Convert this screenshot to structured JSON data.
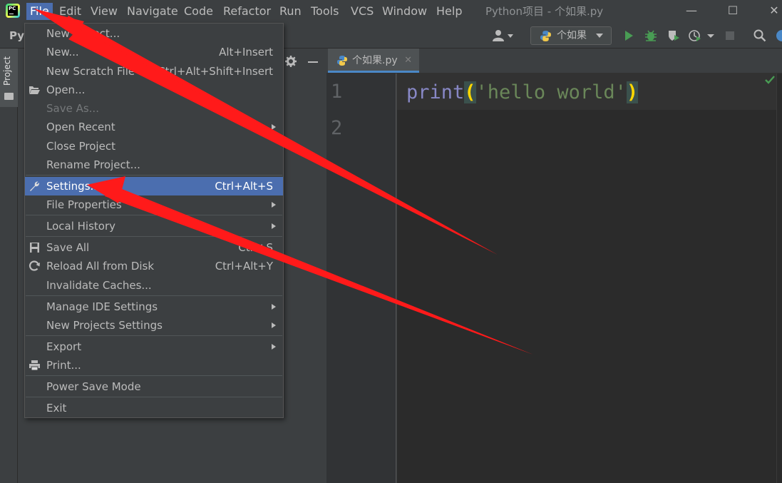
{
  "menubar": {
    "items": [
      "File",
      "Edit",
      "View",
      "Navigate",
      "Code",
      "Refactor",
      "Run",
      "Tools",
      "VCS",
      "Window",
      "Help"
    ],
    "window_title": "Python项目 - 个如果.py",
    "minimize": "—",
    "maximize": "☐",
    "close": "✕"
  },
  "navbar": {
    "project_name": "Py",
    "run_config": "个如果"
  },
  "left_stripe": {
    "project_tab": "Project"
  },
  "editor": {
    "tab_label": "个如果.py",
    "tab_close": "✕",
    "line_numbers": [
      "1",
      "2"
    ],
    "code": {
      "fn": "print",
      "open_paren": "(",
      "string": "'hello world'",
      "close_paren": ")"
    }
  },
  "file_menu": {
    "items": [
      {
        "label": "New Project...",
        "shortcut": "",
        "submenu": false,
        "icon": "",
        "disabled": false,
        "selected": false
      },
      {
        "label": "New...",
        "shortcut": "Alt+Insert",
        "submenu": false,
        "icon": "",
        "disabled": false,
        "selected": false
      },
      {
        "label": "New Scratch File",
        "shortcut": "Ctrl+Alt+Shift+Insert",
        "submenu": false,
        "icon": "",
        "disabled": false,
        "selected": false
      },
      {
        "label": "Open...",
        "shortcut": "",
        "submenu": false,
        "icon": "folder-open-icon",
        "disabled": false,
        "selected": false
      },
      {
        "label": "Save As...",
        "shortcut": "",
        "submenu": false,
        "icon": "",
        "disabled": true,
        "selected": false
      },
      {
        "label": "Open Recent",
        "shortcut": "",
        "submenu": true,
        "icon": "",
        "disabled": false,
        "selected": false
      },
      {
        "label": "Close Project",
        "shortcut": "",
        "submenu": false,
        "icon": "",
        "disabled": false,
        "selected": false
      },
      {
        "label": "Rename Project...",
        "shortcut": "",
        "submenu": false,
        "icon": "",
        "disabled": false,
        "selected": false
      },
      {
        "label": "Settings...",
        "shortcut": "Ctrl+Alt+S",
        "submenu": false,
        "icon": "wrench-icon",
        "disabled": false,
        "selected": true
      },
      {
        "label": "File Properties",
        "shortcut": "",
        "submenu": true,
        "icon": "",
        "disabled": false,
        "selected": false
      },
      {
        "label": "Local History",
        "shortcut": "",
        "submenu": true,
        "icon": "",
        "disabled": false,
        "selected": false
      },
      {
        "label": "Save All",
        "shortcut": "Ctrl+S",
        "submenu": false,
        "icon": "save-icon",
        "disabled": false,
        "selected": false
      },
      {
        "label": "Reload All from Disk",
        "shortcut": "Ctrl+Alt+Y",
        "submenu": false,
        "icon": "reload-icon",
        "disabled": false,
        "selected": false
      },
      {
        "label": "Invalidate Caches...",
        "shortcut": "",
        "submenu": false,
        "icon": "",
        "disabled": false,
        "selected": false
      },
      {
        "label": "Manage IDE Settings",
        "shortcut": "",
        "submenu": true,
        "icon": "",
        "disabled": false,
        "selected": false
      },
      {
        "label": "New Projects Settings",
        "shortcut": "",
        "submenu": true,
        "icon": "",
        "disabled": false,
        "selected": false
      },
      {
        "label": "Export",
        "shortcut": "",
        "submenu": true,
        "icon": "",
        "disabled": false,
        "selected": false
      },
      {
        "label": "Print...",
        "shortcut": "",
        "submenu": false,
        "icon": "print-icon",
        "disabled": false,
        "selected": false
      },
      {
        "label": "Power Save Mode",
        "shortcut": "",
        "submenu": false,
        "icon": "",
        "disabled": false,
        "selected": false
      },
      {
        "label": "Exit",
        "shortcut": "",
        "submenu": false,
        "icon": "",
        "disabled": false,
        "selected": false
      }
    ]
  },
  "colors": {
    "accent": "#4b6eaf",
    "annotation_arrow": "#ff1a1a"
  }
}
